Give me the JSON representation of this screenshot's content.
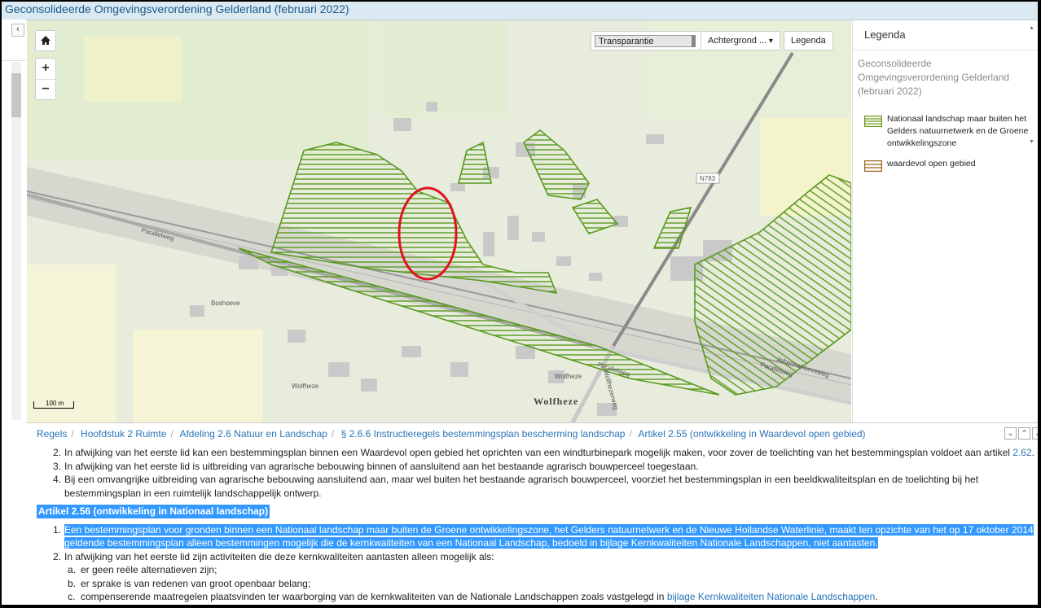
{
  "window": {
    "title": "Geconsolideerde Omgevingsverordening Gelderland (februari 2022)"
  },
  "left_panel": {
    "collapse_glyph": "‹"
  },
  "map": {
    "home_icon": "home-icon",
    "zoom_in": "+",
    "zoom_out": "−",
    "transparency_label": "Transparantie",
    "background_label": "Achtergrond ...",
    "legend_button": "Legenda",
    "scale_label": "100 m",
    "labels": {
      "road": "N783",
      "street1": "Parallelweg",
      "street2": "Parallelweg",
      "street3": "Parallelweg",
      "place1": "Boshoeve",
      "place2": "Wolfheze",
      "place3": "Wolfheze",
      "town": "Wolfheze",
      "street4": "Wolfhezerweg",
      "street5": "Johannahoeveweg"
    },
    "hatch_color": "#5a9a1e",
    "highlight_color": "#e0141e"
  },
  "legend": {
    "header": "Legenda",
    "subtitle": "Geconsolideerde Omgevingsverordening Gelderland (februari 2022)",
    "items": [
      {
        "label": "Nationaal landschap maar buiten het Gelders natuurnetwerk en de Groene ontwikkelingszone",
        "color": "#6a9a1a"
      },
      {
        "label": "waardevol open gebied",
        "color": "#a0621e"
      }
    ]
  },
  "breadcrumbs": [
    "Regels",
    "Hoofdstuk 2 Ruimte",
    "Afdeling 2.6 Natuur en Landschap",
    "§ 2.6.6 Instructieregels bestemmingsplan bescherming landschap",
    "Artikel 2.55 (ontwikkeling in Waardevol open gebied)"
  ],
  "content": {
    "items_prev": [
      {
        "num": "2.",
        "text": "In afwijking van het eerste lid kan een bestemmingsplan binnen een Waardevol open gebied het oprichten van een windturbinepark mogelijk maken, voor zover de toelichting van het bestemmingsplan voldoet aan artikel ",
        "link": "2.62",
        "tail": "."
      },
      {
        "num": "3.",
        "text": "In afwijking van het eerste lid is uitbreiding van agrarische bebouwing binnen of aansluitend aan het bestaande agrarisch bouwperceel toegestaan."
      },
      {
        "num": "4.",
        "text": "Bij een omvangrijke uitbreiding van agrarische bebouwing aansluitend aan, maar wel buiten het bestaande agrarisch bouwperceel, voorziet het bestemmingsplan in een beeldkwaliteitsplan en de toelichting bij het bestemmingsplan in een ruimtelijk landschappelijk ontwerp."
      }
    ],
    "article_heading": "Artikel 2.56 (ontwikkeling in Nationaal landschap)",
    "item1_num": "1.",
    "item1_text": "Een bestemmingsplan voor gronden binnen een Nationaal landschap maar buiten de Groene ontwikkelingszone, het Gelders natuurnetwerk en de Nieuwe Hollandse Waterlinie, maakt ten opzichte van het op 17 oktober 2014 geldende bestemmingsplan alleen bestemmingen mogelijk die de kernkwaliteiten van een Nationaal Landschap, bedoeld in bijlage Kernkwaliteiten Nationale Landschappen, niet aantasten.",
    "item2_num": "2.",
    "item2_text": "In afwijking van het eerste lid zijn activiteiten die deze kernkwaliteiten aantasten alleen mogelijk als:",
    "sub_items": [
      {
        "num": "a.",
        "text": "er geen reële alternatieven zijn;"
      },
      {
        "num": "b.",
        "text": "er sprake is van redenen van groot openbaar belang;"
      },
      {
        "num": "c.",
        "text": "compenserende maatregelen plaatsvinden ter waarborging van de kernkwaliteiten van de Nationale Landschappen zoals vastgelegd in ",
        "link": "bijlage Kernkwaliteiten Nationale Landschappen",
        "tail": "."
      }
    ]
  }
}
